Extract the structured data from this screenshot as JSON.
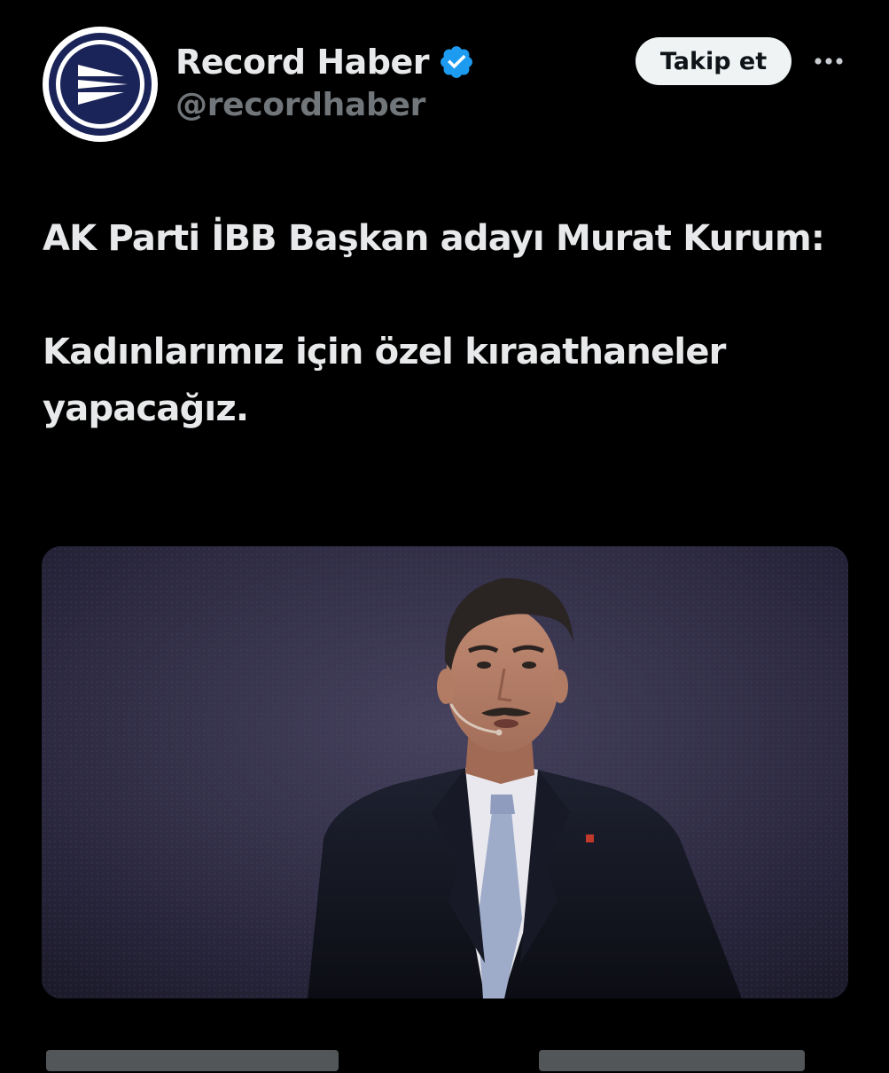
{
  "account": {
    "display_name": "Record Haber",
    "handle": "@recordhaber",
    "verified": true,
    "avatar_icon": "record-haber-logo-icon",
    "verified_icon": "verified-badge-icon",
    "colors": {
      "verified": "#1d9bf0",
      "logo_navy": "#1b2459"
    }
  },
  "actions": {
    "follow_label": "Takip et",
    "more_icon": "more-dots-icon"
  },
  "tweet": {
    "lines": [
      "AK Parti İBB Başkan adayı Murat Kurum:",
      "Kadınlarımız için özel kıraathaneler yapacağız."
    ]
  },
  "media": {
    "type": "photo"
  }
}
